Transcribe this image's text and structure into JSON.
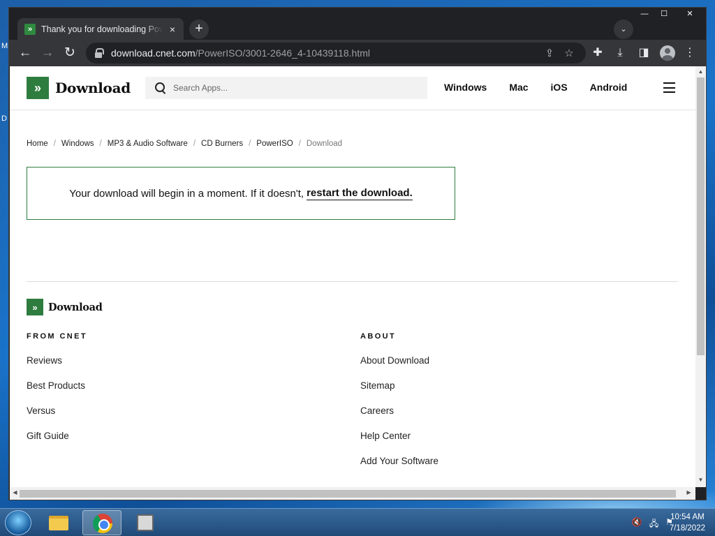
{
  "browser": {
    "tab_title": "Thank you for downloading PowerISO",
    "tab_close": "×",
    "new_tab": "+",
    "url_host": "download.cnet.com",
    "url_path": "/PowerISO/3001-2646_4-10439118.html",
    "window_controls": [
      "—",
      "☐",
      "✕"
    ]
  },
  "site": {
    "logo_text": "Download",
    "search_placeholder": "Search Apps...",
    "nav": [
      "Windows",
      "Mac",
      "iOS",
      "Android"
    ]
  },
  "breadcrumb": [
    "Home",
    "Windows",
    "MP3 & Audio Software",
    "CD Burners",
    "PowerISO",
    "Download"
  ],
  "notice": {
    "text": "Your download will begin in a moment. If it doesn't,",
    "link": "restart the download."
  },
  "footer": {
    "logo_text": "Download",
    "from_cnet": {
      "heading": "FROM CNET",
      "links": [
        "Reviews",
        "Best Products",
        "Versus",
        "Gift Guide"
      ]
    },
    "about": {
      "heading": "ABOUT",
      "links": [
        "About Download",
        "Sitemap",
        "Careers",
        "Help Center",
        "Add Your Software"
      ]
    }
  },
  "taskbar": {
    "time": "10:54 AM",
    "date": "7/18/2022"
  },
  "colors": {
    "brand_green": "#2e7d3f",
    "chrome_dark": "#202124"
  }
}
